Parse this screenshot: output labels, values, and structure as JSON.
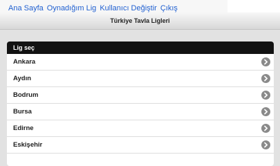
{
  "nav": {
    "home": "Ana Sayfa",
    "my_league": "Oynadığım Lig",
    "switch_user": "Kullanıcı Değiştir",
    "logout": "Çıkış"
  },
  "header": {
    "title": "Türkiye Tavla Ligleri"
  },
  "panel": {
    "heading": "Lig seç",
    "items": [
      {
        "label": "Ankara"
      },
      {
        "label": "Aydın"
      },
      {
        "label": "Bodrum"
      },
      {
        "label": "Bursa"
      },
      {
        "label": "Edirne"
      },
      {
        "label": "Eskişehir"
      }
    ]
  },
  "icons": {
    "row_arrow": "chevron-right-icon"
  }
}
